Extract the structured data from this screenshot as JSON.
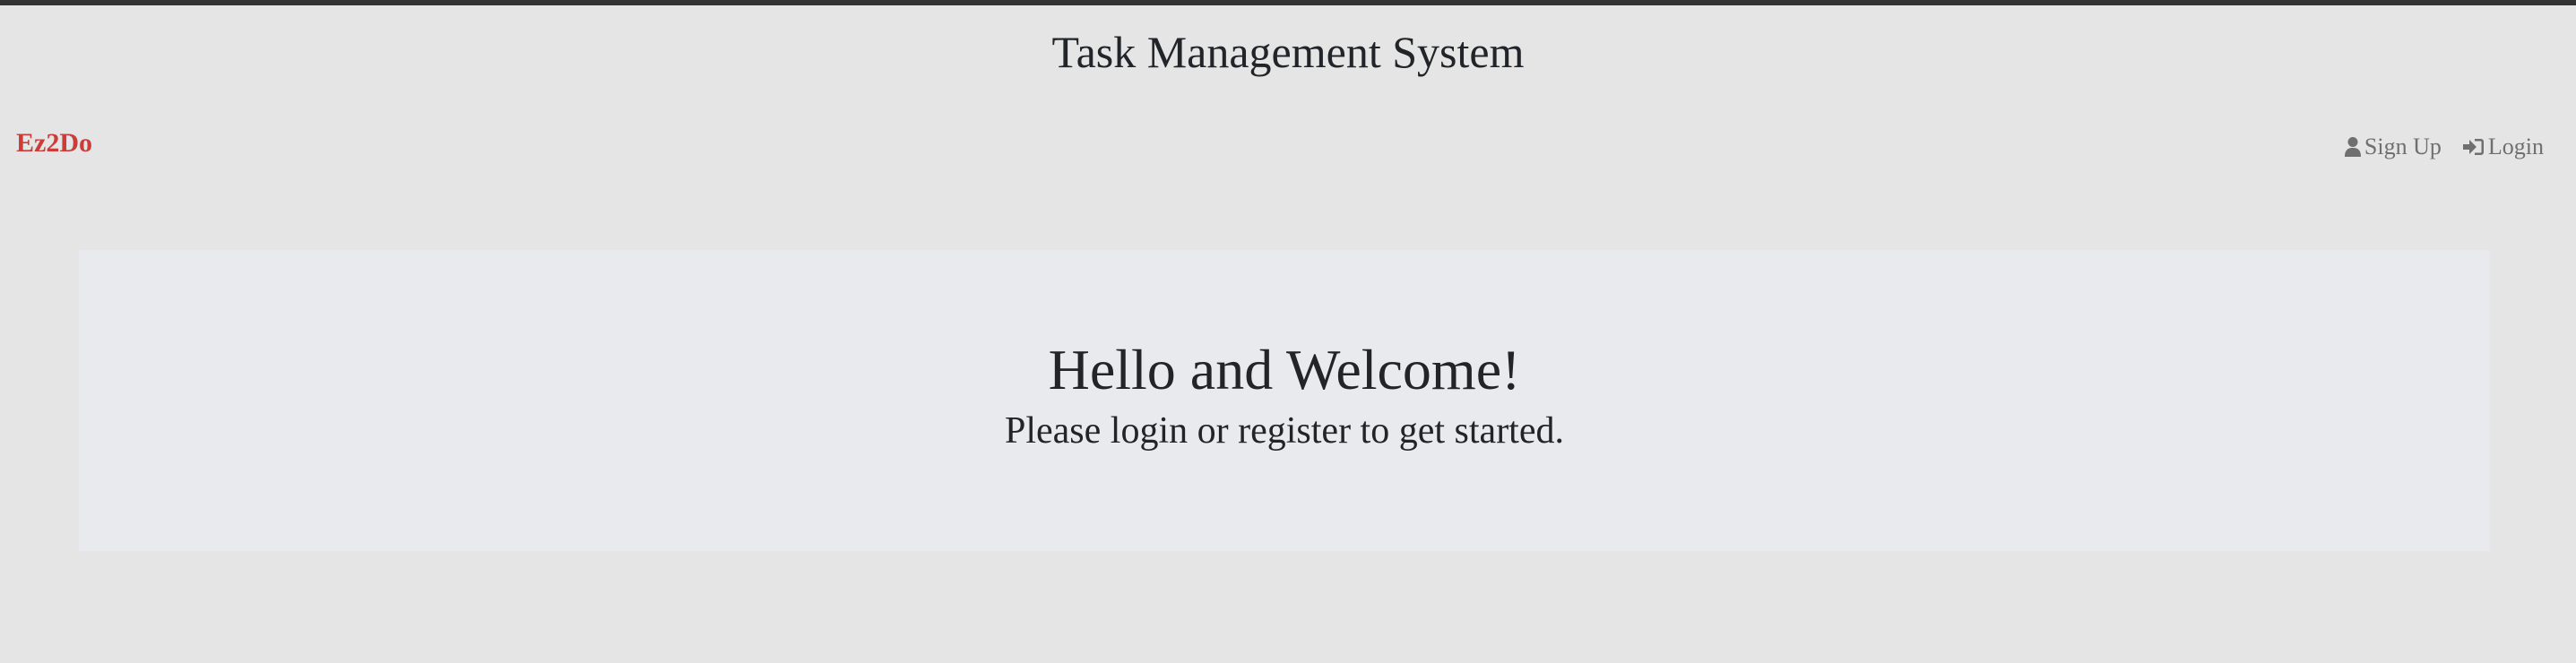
{
  "header": {
    "title": "Task Management System"
  },
  "navbar": {
    "brand": "Ez2Do",
    "brand_color": "#cc3d3a",
    "links": [
      {
        "label": "Sign Up",
        "icon": "user-icon"
      },
      {
        "label": "Login",
        "icon": "sign-in-icon"
      }
    ]
  },
  "jumbotron": {
    "heading": "Hello and Welcome!",
    "subheading": "Please login or register to get started."
  }
}
